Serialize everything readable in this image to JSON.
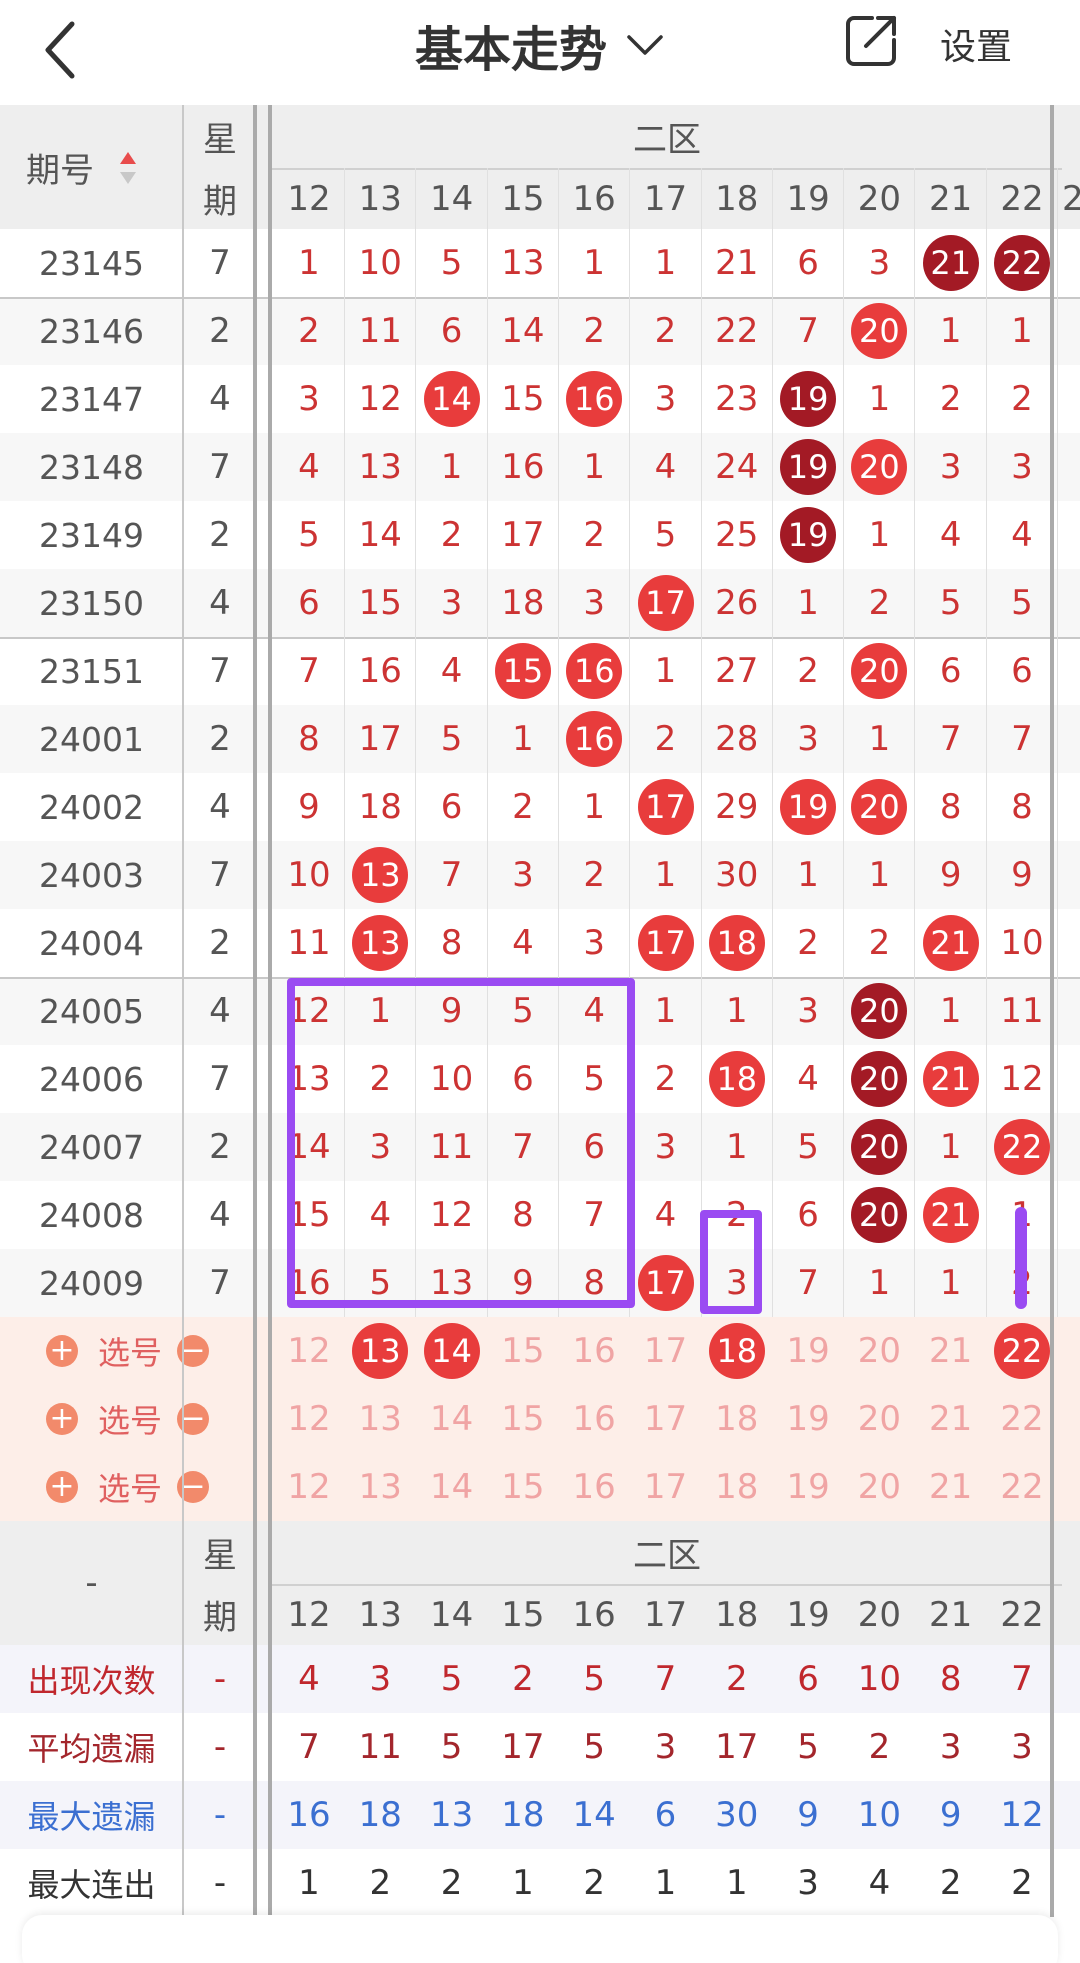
{
  "header": {
    "title": "基本走势",
    "settings_label": "设置"
  },
  "table": {
    "col_issue": "期号",
    "col_week_line1": "星",
    "col_week_line2": "期",
    "zone_label": "二区",
    "columns": [
      "12",
      "13",
      "14",
      "15",
      "16",
      "17",
      "18",
      "19",
      "20",
      "21",
      "22"
    ],
    "rows": [
      {
        "issue": "23145",
        "week": "7",
        "vals": [
          "1",
          "10",
          "5",
          "13",
          "1",
          "1",
          "21",
          "6",
          "3",
          "21",
          "22"
        ],
        "balls": [
          null,
          null,
          null,
          null,
          null,
          null,
          null,
          null,
          null,
          "dark",
          "dark"
        ]
      },
      {
        "issue": "23146",
        "week": "2",
        "vals": [
          "2",
          "11",
          "6",
          "14",
          "2",
          "2",
          "22",
          "7",
          "20",
          "1",
          "1"
        ],
        "balls": [
          null,
          null,
          null,
          null,
          null,
          null,
          null,
          null,
          "red",
          null,
          null
        ]
      },
      {
        "issue": "23147",
        "week": "4",
        "vals": [
          "3",
          "12",
          "14",
          "15",
          "16",
          "3",
          "23",
          "19",
          "1",
          "2",
          "2"
        ],
        "balls": [
          null,
          null,
          "red",
          null,
          "red",
          null,
          null,
          "dark",
          null,
          null,
          null
        ]
      },
      {
        "issue": "23148",
        "week": "7",
        "vals": [
          "4",
          "13",
          "1",
          "16",
          "1",
          "4",
          "24",
          "19",
          "20",
          "3",
          "3"
        ],
        "balls": [
          null,
          null,
          null,
          null,
          null,
          null,
          null,
          "dark",
          "red",
          null,
          null
        ]
      },
      {
        "issue": "23149",
        "week": "2",
        "vals": [
          "5",
          "14",
          "2",
          "17",
          "2",
          "5",
          "25",
          "19",
          "1",
          "4",
          "4"
        ],
        "balls": [
          null,
          null,
          null,
          null,
          null,
          null,
          null,
          "dark",
          null,
          null,
          null
        ]
      },
      {
        "issue": "23150",
        "week": "4",
        "vals": [
          "6",
          "15",
          "3",
          "18",
          "3",
          "17",
          "26",
          "1",
          "2",
          "5",
          "5"
        ],
        "balls": [
          null,
          null,
          null,
          null,
          null,
          "red",
          null,
          null,
          null,
          null,
          null
        ]
      },
      {
        "issue": "23151",
        "week": "7",
        "vals": [
          "7",
          "16",
          "4",
          "15",
          "16",
          "1",
          "27",
          "2",
          "20",
          "6",
          "6"
        ],
        "balls": [
          null,
          null,
          null,
          "red",
          "red",
          null,
          null,
          null,
          "red",
          null,
          null
        ]
      },
      {
        "issue": "24001",
        "week": "2",
        "vals": [
          "8",
          "17",
          "5",
          "1",
          "16",
          "2",
          "28",
          "3",
          "1",
          "7",
          "7"
        ],
        "balls": [
          null,
          null,
          null,
          null,
          "red",
          null,
          null,
          null,
          null,
          null,
          null
        ]
      },
      {
        "issue": "24002",
        "week": "4",
        "vals": [
          "9",
          "18",
          "6",
          "2",
          "1",
          "17",
          "29",
          "19",
          "20",
          "8",
          "8"
        ],
        "balls": [
          null,
          null,
          null,
          null,
          null,
          "red",
          null,
          "red",
          "red",
          null,
          null
        ]
      },
      {
        "issue": "24003",
        "week": "7",
        "vals": [
          "10",
          "13",
          "7",
          "3",
          "2",
          "1",
          "30",
          "1",
          "1",
          "9",
          "9"
        ],
        "balls": [
          null,
          "red",
          null,
          null,
          null,
          null,
          null,
          null,
          null,
          null,
          null
        ]
      },
      {
        "issue": "24004",
        "week": "2",
        "vals": [
          "11",
          "13",
          "8",
          "4",
          "3",
          "17",
          "18",
          "2",
          "2",
          "21",
          "10"
        ],
        "balls": [
          null,
          "red",
          null,
          null,
          null,
          "red",
          "red",
          null,
          null,
          "red",
          null
        ]
      },
      {
        "issue": "24005",
        "week": "4",
        "vals": [
          "12",
          "1",
          "9",
          "5",
          "4",
          "1",
          "1",
          "3",
          "20",
          "1",
          "11"
        ],
        "balls": [
          null,
          null,
          null,
          null,
          null,
          null,
          null,
          null,
          "dark",
          null,
          null
        ]
      },
      {
        "issue": "24006",
        "week": "7",
        "vals": [
          "13",
          "2",
          "10",
          "6",
          "5",
          "2",
          "18",
          "4",
          "20",
          "21",
          "12"
        ],
        "balls": [
          null,
          null,
          null,
          null,
          null,
          null,
          "red",
          null,
          "dark",
          "red",
          null
        ]
      },
      {
        "issue": "24007",
        "week": "2",
        "vals": [
          "14",
          "3",
          "11",
          "7",
          "6",
          "3",
          "1",
          "5",
          "20",
          "1",
          "22"
        ],
        "balls": [
          null,
          null,
          null,
          null,
          null,
          null,
          null,
          null,
          "dark",
          null,
          "red"
        ]
      },
      {
        "issue": "24008",
        "week": "4",
        "vals": [
          "15",
          "4",
          "12",
          "8",
          "7",
          "4",
          "2",
          "6",
          "20",
          "21",
          "1"
        ],
        "balls": [
          null,
          null,
          null,
          null,
          null,
          null,
          null,
          null,
          "dark",
          "red",
          null
        ]
      },
      {
        "issue": "24009",
        "week": "7",
        "vals": [
          "16",
          "5",
          "13",
          "9",
          "8",
          "17",
          "3",
          "7",
          "1",
          "1",
          "2"
        ],
        "balls": [
          null,
          null,
          null,
          null,
          null,
          "red",
          null,
          null,
          null,
          null,
          null
        ]
      }
    ],
    "selection_rows": [
      {
        "label": "选号",
        "balls": [
          null,
          "red",
          "red",
          null,
          null,
          null,
          "red",
          null,
          null,
          null,
          "red"
        ]
      },
      {
        "label": "选号",
        "balls": [
          null,
          null,
          null,
          null,
          null,
          null,
          null,
          null,
          null,
          null,
          null
        ]
      },
      {
        "label": "选号",
        "balls": [
          null,
          null,
          null,
          null,
          null,
          null,
          null,
          null,
          null,
          null,
          null
        ]
      }
    ],
    "footer_dash": "-",
    "stats": [
      {
        "label": "出现次数",
        "color": "#c0272d",
        "week": "-",
        "vals": [
          "4",
          "3",
          "5",
          "2",
          "5",
          "7",
          "2",
          "6",
          "10",
          "8",
          "7"
        ],
        "val_color": "#c0272d"
      },
      {
        "label": "平均遗漏",
        "color": "#a3262c",
        "week": "-",
        "vals": [
          "7",
          "11",
          "5",
          "17",
          "5",
          "3",
          "17",
          "5",
          "2",
          "3",
          "3"
        ],
        "val_color": "#a3262c"
      },
      {
        "label": "最大遗漏",
        "color": "#3b6fd1",
        "week": "-",
        "vals": [
          "16",
          "18",
          "13",
          "18",
          "14",
          "6",
          "30",
          "9",
          "10",
          "9",
          "12"
        ],
        "val_color": "#3b6fd1"
      },
      {
        "label": "最大连出",
        "color": "#333333",
        "week": "-",
        "vals": [
          "1",
          "2",
          "2",
          "1",
          "2",
          "1",
          "1",
          "3",
          "4",
          "2",
          "2"
        ],
        "val_color": "#333333"
      }
    ]
  },
  "colors": {
    "ball_red": "#e83c3c",
    "ball_dark": "#a31a25",
    "annotation": "#9a4bf2",
    "selection_bg": "#fdeee8"
  }
}
